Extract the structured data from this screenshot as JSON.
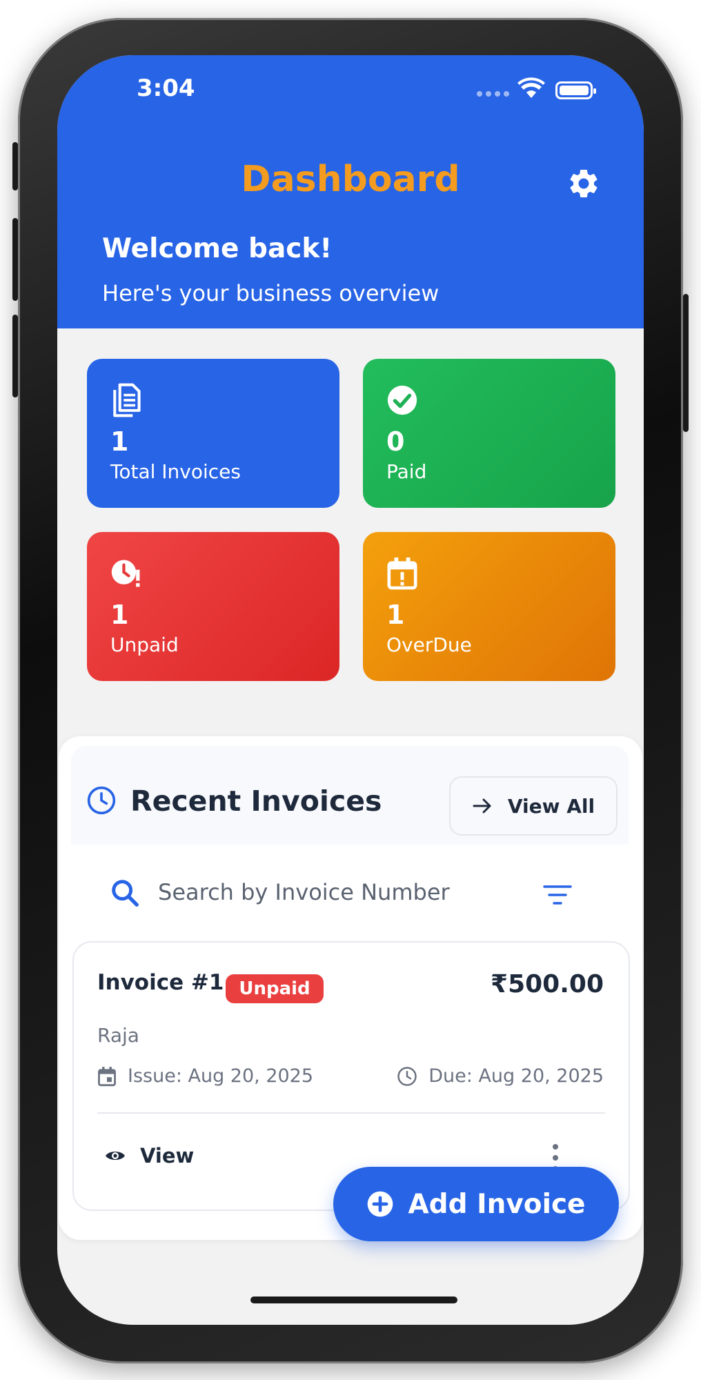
{
  "status_bar": {
    "time": "3:04"
  },
  "header": {
    "title": "Dashboard",
    "welcome": "Welcome back!",
    "subtitle": "Here's your business overview"
  },
  "stats": [
    {
      "value": "1",
      "label": "Total Invoices",
      "icon": "document-icon",
      "color": "#2864e6"
    },
    {
      "value": "0",
      "label": "Paid",
      "icon": "check-circle-icon",
      "color": "#1fb155"
    },
    {
      "value": "1",
      "label": "Unpaid",
      "icon": "clock-alert-icon",
      "color": "#e63a3a"
    },
    {
      "value": "1",
      "label": "OverDue",
      "icon": "calendar-alert-icon",
      "color": "#ea8a0a"
    }
  ],
  "recent": {
    "title": "Recent Invoices",
    "view_all": "View All",
    "search_placeholder": "Search by Invoice Number"
  },
  "invoice": {
    "title": "Invoice #1",
    "status": "Unpaid",
    "amount": "₹500.00",
    "customer": "Raja",
    "issue": "Issue: Aug 20, 2025",
    "due": "Due: Aug 20, 2025",
    "view": "View"
  },
  "fab": {
    "label": "Add Invoice"
  },
  "colors": {
    "primary": "#2864e6",
    "title_accent": "#f39c1f",
    "unpaid_badge": "#ea3f3f"
  }
}
